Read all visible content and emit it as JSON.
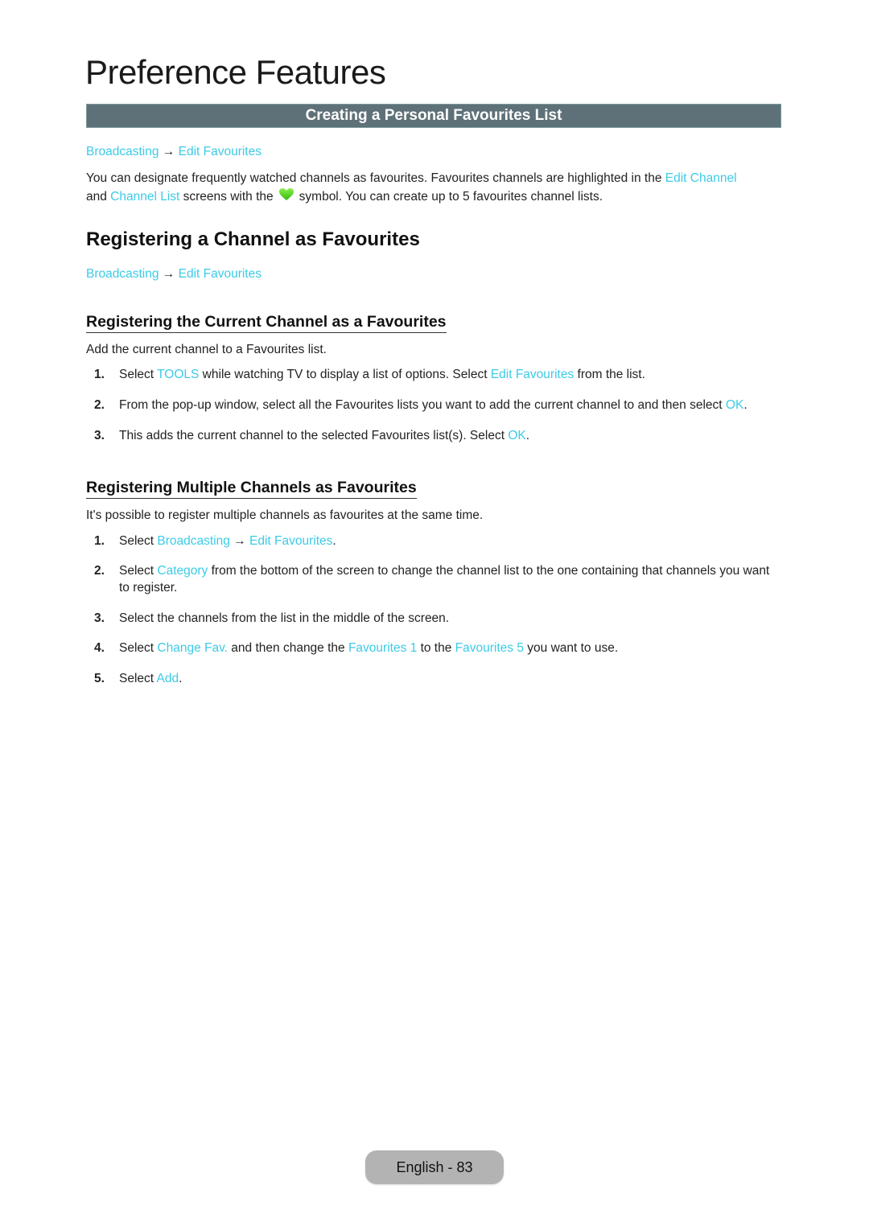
{
  "page": {
    "title": "Preference Features",
    "section_banner": "Creating a Personal Favourites List",
    "footer": "English - 83"
  },
  "colors": {
    "link": "#3ccbe6",
    "banner_bg": "#5f7178",
    "heart_icon": "#4fd11e",
    "footer_pill": "#b3b3b3"
  },
  "intro": {
    "path": {
      "from": "Broadcasting",
      "arrow": "→",
      "to": "Edit Favourites"
    },
    "text_1": "You can designate frequently watched channels as favourites. Favourites channels are highlighted in the ",
    "link_1": "Edit Channel",
    "text_2": "and ",
    "link_2": "Channel List",
    "text_3": " screens with the",
    "icon": "heart-icon",
    "text_4": "symbol. You can create up to 5 favourites channel lists."
  },
  "registering": {
    "heading": "Registering a Channel as Favourites",
    "path": {
      "from": "Broadcasting",
      "arrow": "→",
      "to": "Edit Favourites"
    }
  },
  "current_channel": {
    "heading": "Registering the Current Channel as a Favourites",
    "intro": "Add the current channel to a Favourites list.",
    "steps": [
      {
        "num": "1.",
        "parts": [
          {
            "t": "Select "
          },
          {
            "t": "TOOLS",
            "link": true
          },
          {
            "t": " while watching TV to display a list of options. Select "
          },
          {
            "t": "Edit Favourites",
            "link": true
          },
          {
            "t": " from the list."
          }
        ]
      },
      {
        "num": "2.",
        "parts": [
          {
            "t": "From the pop-up window, select all the Favourites lists you want to add the current channel to and then select "
          },
          {
            "t": "OK",
            "link": true
          },
          {
            "t": "."
          }
        ]
      },
      {
        "num": "3.",
        "parts": [
          {
            "t": "This adds the current channel to the selected Favourites list(s). Select "
          },
          {
            "t": "OK",
            "link": true
          },
          {
            "t": "."
          }
        ]
      }
    ]
  },
  "multiple_channels": {
    "heading": "Registering Multiple Channels as Favourites",
    "intro": "It's possible to register multiple channels as favourites at the same time.",
    "steps": [
      {
        "num": "1.",
        "parts": [
          {
            "t": "Select "
          },
          {
            "t": "Broadcasting",
            "link": true
          },
          {
            "t": " → "
          },
          {
            "t": "Edit Favourites",
            "link": true
          },
          {
            "t": "."
          }
        ]
      },
      {
        "num": "2.",
        "parts": [
          {
            "t": "Select "
          },
          {
            "t": "Category",
            "link": true
          },
          {
            "t": " from the bottom of the screen to change the channel list to the one containing that channels you want to register."
          }
        ]
      },
      {
        "num": "3.",
        "parts": [
          {
            "t": "Select the channels from the list in the middle of the screen."
          }
        ]
      },
      {
        "num": "4.",
        "parts": [
          {
            "t": "Select "
          },
          {
            "t": "Change Fav.",
            "link": true
          },
          {
            "t": " and then change the "
          },
          {
            "t": "Favourites 1",
            "link": true
          },
          {
            "t": " to the "
          },
          {
            "t": "Favourites 5",
            "link": true
          },
          {
            "t": " you want to use."
          }
        ]
      },
      {
        "num": "5.",
        "parts": [
          {
            "t": "Select "
          },
          {
            "t": "Add",
            "link": true
          },
          {
            "t": "."
          }
        ]
      }
    ]
  }
}
